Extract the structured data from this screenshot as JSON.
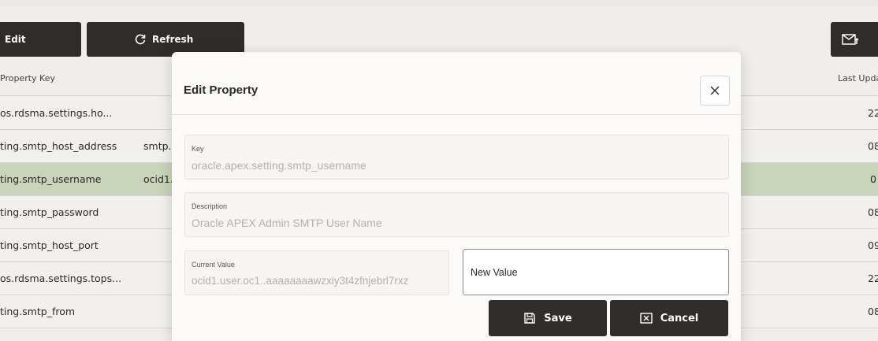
{
  "toolbar": {
    "edit_label": "Edit",
    "refresh_label": "Refresh"
  },
  "table": {
    "headers": {
      "property_key": "Property Key",
      "last_updated": "Last Upda"
    },
    "rows": [
      {
        "key": "os.rdsma.settings.ho...",
        "value": "",
        "last": "22"
      },
      {
        "key": "ting.smtp_host_address",
        "value": "smtp.",
        "last": "08"
      },
      {
        "key": "ting.smtp_username",
        "value": "ocid1.",
        "last": "0"
      },
      {
        "key": "ting.smtp_password",
        "value": "",
        "last": "08"
      },
      {
        "key": "ting.smtp_host_port",
        "value": "",
        "last": "09"
      },
      {
        "key": "os.rdsma.settings.tops...",
        "value": "",
        "last": "22"
      },
      {
        "key": "ting.smtp_from",
        "value": "",
        "last": "08"
      }
    ]
  },
  "modal": {
    "title": "Edit Property",
    "key_label": "Key",
    "key_value": "oracle.apex.setting.smtp_username",
    "description_label": "Description",
    "description_value": "Oracle APEX Admin SMTP User Name",
    "current_label": "Current Value",
    "current_value": "ocid1.user.oc1..aaaaaaaawzxiy3t4zfnjebrl7rxz",
    "new_value_placeholder": "New Value",
    "save_label": "Save",
    "cancel_label": "Cancel"
  },
  "colors": {
    "dark_button": "#312d2a",
    "selected_row": "#cfd9bf"
  }
}
